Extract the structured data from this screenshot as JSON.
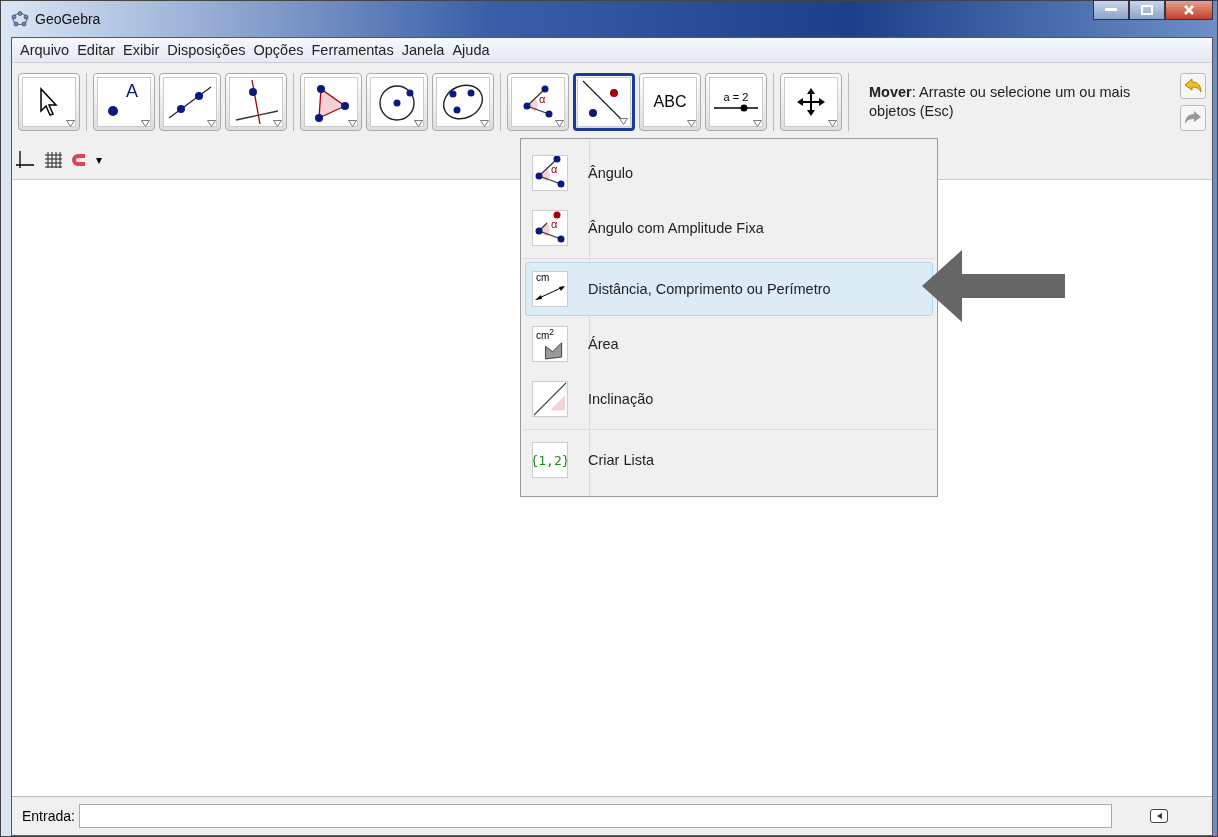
{
  "window": {
    "title": "GeoGebra"
  },
  "menu": [
    "Arquivo",
    "Editar",
    "Exibir",
    "Disposições",
    "Opções",
    "Ferramentas",
    "Janela",
    "Ajuda"
  ],
  "toolbar": {
    "groups": [
      [
        {
          "kind": "pointer",
          "selected": false
        }
      ],
      [
        {
          "kind": "point",
          "selected": false,
          "glyph": "A"
        },
        {
          "kind": "line",
          "selected": false
        },
        {
          "kind": "perpendicular",
          "selected": false
        }
      ],
      [
        {
          "kind": "polygon",
          "selected": false
        },
        {
          "kind": "circle",
          "selected": false
        },
        {
          "kind": "conic",
          "selected": false
        }
      ],
      [
        {
          "kind": "angle",
          "selected": false,
          "glyph": "α"
        },
        {
          "kind": "relation",
          "selected": true
        },
        {
          "kind": "text",
          "selected": false,
          "glyph": "ABC"
        },
        {
          "kind": "slider",
          "selected": false,
          "glyph": "a = 2"
        }
      ],
      [
        {
          "kind": "move-view",
          "selected": false
        }
      ]
    ],
    "help": "**Mover**: Arraste ou selecione um ou mais objetos (Esc)",
    "undo": {
      "disabled": false
    },
    "redo": {
      "disabled": true
    }
  },
  "style_bar": {
    "caret": "▾"
  },
  "dropdown": {
    "groups": [
      [
        {
          "kind": "angle",
          "glyph": "α",
          "label": "Ângulo",
          "selected": false
        },
        {
          "kind": "fixed-angle",
          "glyph": "α",
          "label": "Ângulo com Amplitude Fixa",
          "selected": false
        }
      ],
      [
        {
          "kind": "distance",
          "glyph": "cm",
          "label": "Distância, Comprimento ou Perímetro",
          "selected": true
        },
        {
          "kind": "area",
          "glyph": "cm$^{2}$",
          "label": "Área",
          "selected": false
        },
        {
          "kind": "slope",
          "label": "Inclinação",
          "selected": false
        }
      ],
      [
        {
          "kind": "list",
          "glyph": "{1,2}",
          "label": "Criar Lista",
          "selected": false
        }
      ]
    ]
  },
  "input_bar": {
    "label": "Entrada:"
  }
}
